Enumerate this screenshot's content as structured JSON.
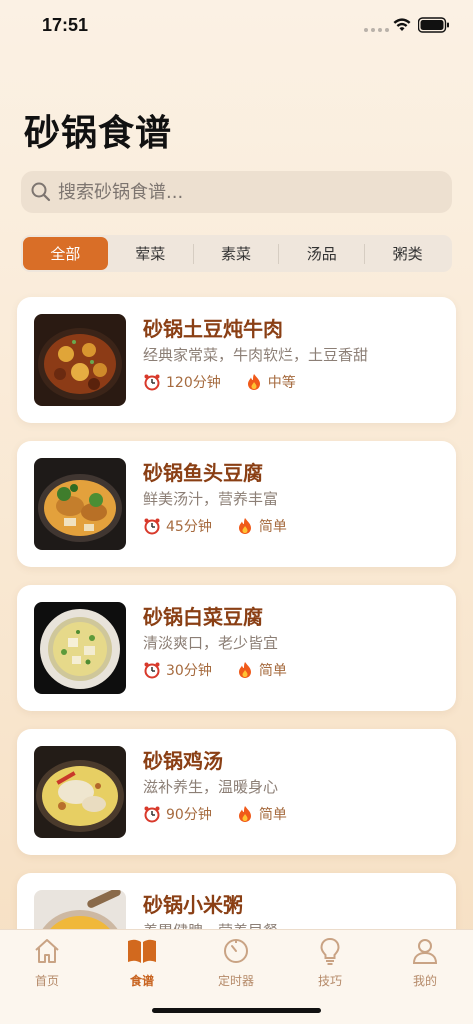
{
  "status_bar": {
    "time": "17:51"
  },
  "header": {
    "title": "砂锅食谱"
  },
  "search": {
    "placeholder": "搜索砂锅食谱..."
  },
  "categories": [
    {
      "label": "全部",
      "active": true
    },
    {
      "label": "荤菜",
      "active": false
    },
    {
      "label": "素菜",
      "active": false
    },
    {
      "label": "汤品",
      "active": false
    },
    {
      "label": "粥类",
      "active": false
    }
  ],
  "recipes": [
    {
      "title": "砂锅土豆炖牛肉",
      "desc": "经典家常菜，牛肉软烂，土豆香甜",
      "time": "120分钟",
      "difficulty": "中等"
    },
    {
      "title": "砂锅鱼头豆腐",
      "desc": "鲜美汤汁，营养丰富",
      "time": "45分钟",
      "difficulty": "简单"
    },
    {
      "title": "砂锅白菜豆腐",
      "desc": "清淡爽口，老少皆宜",
      "time": "30分钟",
      "difficulty": "简单"
    },
    {
      "title": "砂锅鸡汤",
      "desc": "滋补养生，温暖身心",
      "time": "90分钟",
      "difficulty": "简单"
    },
    {
      "title": "砂锅小米粥",
      "desc": "养胃健脾，营养早餐",
      "time": "",
      "difficulty": ""
    }
  ],
  "tab_bar": [
    {
      "label": "首页",
      "icon": "home-icon",
      "active": false
    },
    {
      "label": "食谱",
      "icon": "book-icon",
      "active": true
    },
    {
      "label": "定时器",
      "icon": "timer-icon",
      "active": false
    },
    {
      "label": "技巧",
      "icon": "lightbulb-icon",
      "active": false
    },
    {
      "label": "我的",
      "icon": "person-icon",
      "active": false
    }
  ],
  "colors": {
    "accent": "#d96e27",
    "title_text": "#8a3f14",
    "meta_text": "#a66b3f",
    "tab_inactive": "#b58a69"
  }
}
